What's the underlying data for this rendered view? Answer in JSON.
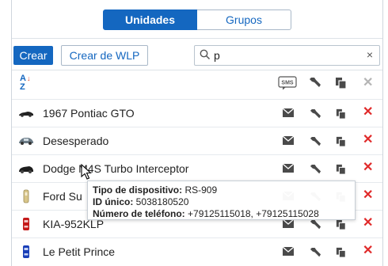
{
  "tabs": {
    "active": "Unidades",
    "inactive": "Grupos"
  },
  "toolbar": {
    "create_label": "Crear",
    "create_wlp_label": "Crear de WLP"
  },
  "search": {
    "value": "p",
    "clear": "×"
  },
  "header_icons": [
    "sort-az-icon",
    "sms-icon",
    "wrench-icon",
    "copy-icon",
    "delete-icon"
  ],
  "header": {
    "sms": "SMS"
  },
  "units": [
    {
      "name": "1967 Pontiac GTO",
      "icon": "black-car-icon"
    },
    {
      "name": "Desesperado",
      "icon": "grey-car-icon"
    },
    {
      "name": "Dodge M4S Turbo Interceptor",
      "icon": "black-sports-car-icon"
    },
    {
      "name": "Ford Su",
      "icon": "bottle-car-icon"
    },
    {
      "name": "KIA-952KLP",
      "icon": "red-car-icon"
    },
    {
      "name": "Le Petit Prince",
      "icon": "blue-car-icon"
    }
  ],
  "tooltip": {
    "device_type_label": "Tipo de dispositivo:",
    "device_type": "RS-909",
    "unique_id_label": "ID único:",
    "unique_id": "5038180520",
    "phone_label": "Número de teléfono:",
    "phone": "+79125115018, +79125115028"
  },
  "colors": {
    "accent": "#1467c0",
    "delete": "#e02a2a",
    "icon": "#4a4a4a"
  }
}
